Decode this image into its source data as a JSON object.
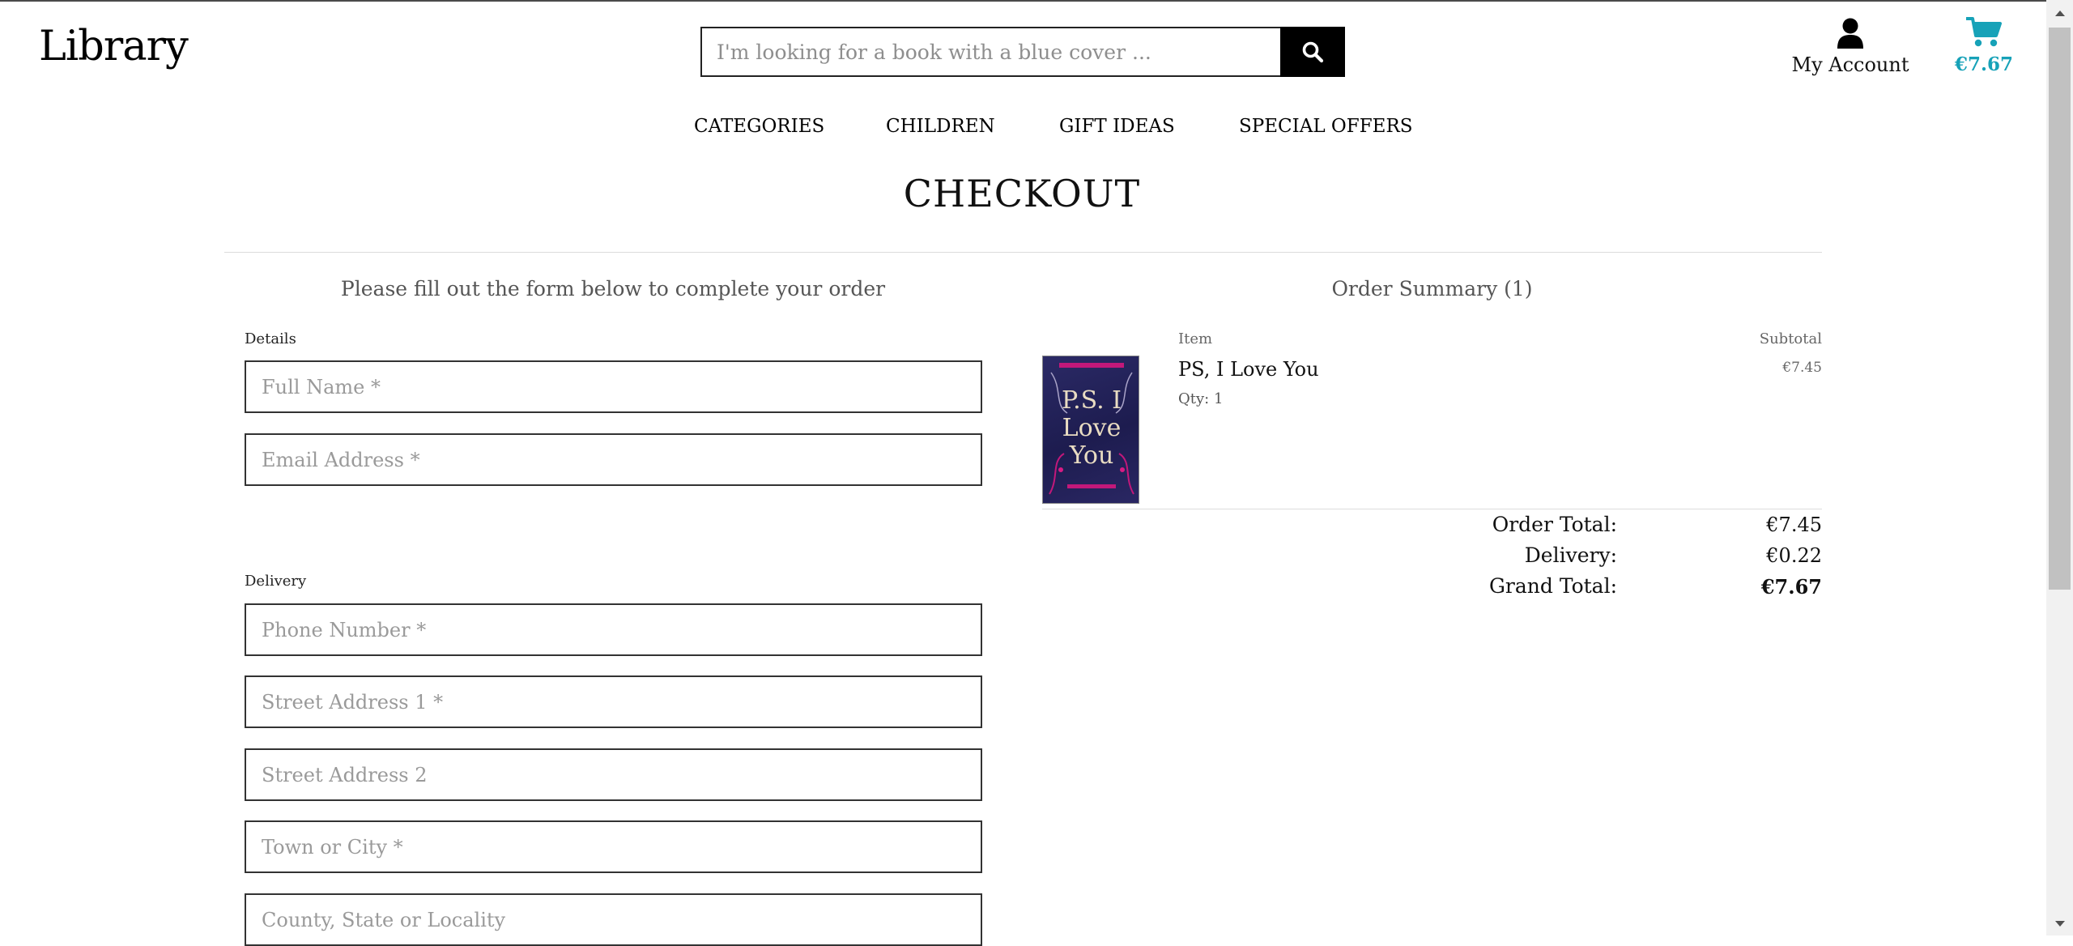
{
  "header": {
    "logo": "Library",
    "search_placeholder": "I'm looking for a book with a blue cover ...",
    "account_label": "My Account",
    "cart_total": "€7.67",
    "accent_color": "#17a2b8"
  },
  "nav": {
    "items": [
      "CATEGORIES",
      "CHILDREN",
      "GIFT IDEAS",
      "SPECIAL OFFERS"
    ]
  },
  "page": {
    "title": "CHECKOUT"
  },
  "form": {
    "intro": "Please fill out the form below to complete your order",
    "details_label": "Details",
    "full_name_placeholder": "Full Name *",
    "email_placeholder": "Email Address *",
    "delivery_label": "Delivery",
    "phone_placeholder": "Phone Number *",
    "street1_placeholder": "Street Address 1 *",
    "street2_placeholder": "Street Address 2",
    "town_placeholder": "Town or City *",
    "county_placeholder": "County, State or Locality"
  },
  "summary": {
    "heading": "Order Summary (1)",
    "item_col": "Item",
    "subtotal_col": "Subtotal",
    "item": {
      "title": "PS, I Love You",
      "qty": "Qty: 1",
      "subtotal": "€7.45",
      "cover_text": "P.S. I Love You"
    },
    "order_total_label": "Order Total:",
    "order_total": "€7.45",
    "delivery_label": "Delivery:",
    "delivery": "€0.22",
    "grand_total_label": "Grand Total:",
    "grand_total": "€7.67"
  }
}
